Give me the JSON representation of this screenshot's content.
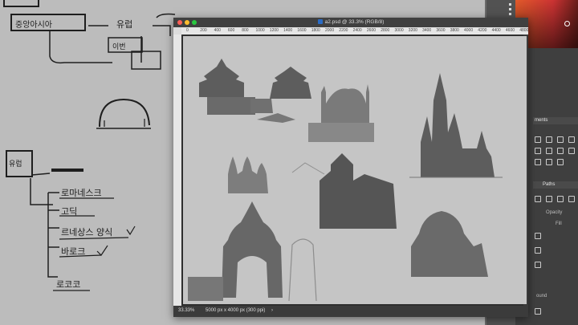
{
  "board": {
    "notes": [
      "중앙아시아",
      "유럽",
      "이번",
      "로마네스크",
      "고딕",
      "르네상스 양식",
      "바로크",
      "로코코"
    ]
  },
  "document": {
    "title": "a2.psd @ 33.3% (RGB/8)",
    "ruler_ticks": [
      "0",
      "200",
      "400",
      "600",
      "800",
      "1000",
      "1200",
      "1400",
      "1600",
      "1800",
      "2000",
      "2200",
      "2400",
      "2600",
      "2800",
      "3000",
      "3200",
      "3400",
      "3600",
      "3800",
      "4000",
      "4200",
      "4400",
      "4600",
      "4800"
    ],
    "zoom": "33.33%",
    "doc_size": "5000 px x 4000 px (300 ppi)"
  },
  "panels": {
    "adjustments_tab": "ments",
    "paths_tab": "Paths",
    "opacity_label": "Opacity",
    "fill_label": "Fill",
    "round_label": "ound"
  },
  "colors": {
    "board": "#bcbcbc",
    "window": "#2f2f2f",
    "canvas": "#c5c5c5",
    "close": "#ff5f57",
    "minimize": "#febc2e",
    "zoom": "#28c840"
  }
}
